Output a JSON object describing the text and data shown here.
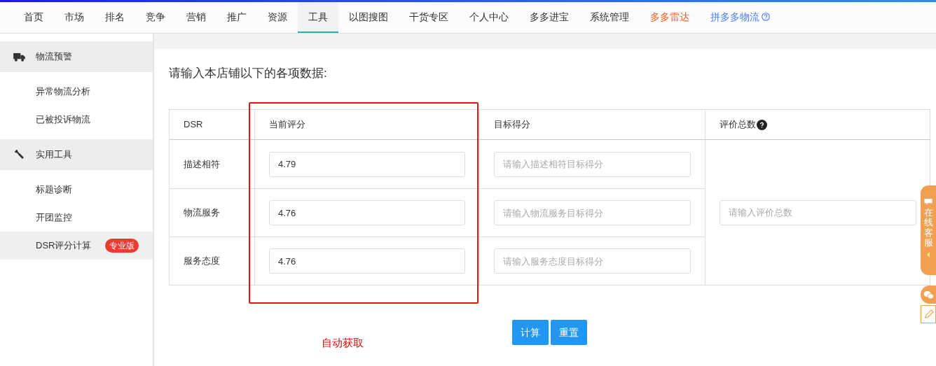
{
  "nav": [
    {
      "label": "首页",
      "selected": false,
      "color": "#333333"
    },
    {
      "label": "市场",
      "selected": false,
      "color": "#333333"
    },
    {
      "label": "排名",
      "selected": false,
      "color": "#333333"
    },
    {
      "label": "竞争",
      "selected": false,
      "color": "#333333"
    },
    {
      "label": "营销",
      "selected": false,
      "color": "#333333"
    },
    {
      "label": "推广",
      "selected": false,
      "color": "#333333"
    },
    {
      "label": "资源",
      "selected": false,
      "color": "#333333"
    },
    {
      "label": "工具",
      "selected": true,
      "color": "#333333"
    },
    {
      "label": "以图搜图",
      "selected": false,
      "color": "#333333"
    },
    {
      "label": "干货专区",
      "selected": false,
      "color": "#333333"
    },
    {
      "label": "个人中心",
      "selected": false,
      "color": "#333333"
    },
    {
      "label": "多多进宝",
      "selected": false,
      "color": "#333333"
    },
    {
      "label": "系统管理",
      "selected": false,
      "color": "#333333"
    },
    {
      "label": "多多雷达",
      "selected": false,
      "color": "#ff5a1f"
    },
    {
      "label": "拼多多物流",
      "selected": false,
      "color": "#4a80f0",
      "help": true
    }
  ],
  "sidebar": [
    {
      "label": "物流预警",
      "items": [
        {
          "label": "异常物流分析",
          "selected": false
        },
        {
          "label": "已被投诉物流",
          "selected": false
        }
      ]
    },
    {
      "label": "实用工具",
      "items": [
        {
          "label": "标题诊断",
          "selected": false
        },
        {
          "label": "开团监控",
          "selected": false
        },
        {
          "label": "DSR评分计算",
          "selected": true,
          "badge": "专业版"
        }
      ]
    }
  ],
  "heading": "请输入本店铺以下的各项数据:",
  "table": {
    "columns": [
      "DSR",
      "当前评分",
      "目标得分",
      "评价总数"
    ],
    "rows": [
      {
        "label": "描述相符",
        "current": "4.79",
        "target_placeholder": "请输入描述相符目标得分"
      },
      {
        "label": "物流服务",
        "current": "4.76",
        "target_placeholder": "请输入物流服务目标得分"
      },
      {
        "label": "服务态度",
        "current": "4.76",
        "target_placeholder": "请输入服务态度目标得分"
      }
    ],
    "total_placeholder": "请输入评价总数"
  },
  "annotation": "自动获取",
  "buttons": [
    "计算",
    "重置"
  ],
  "service_tab": "在线客服"
}
